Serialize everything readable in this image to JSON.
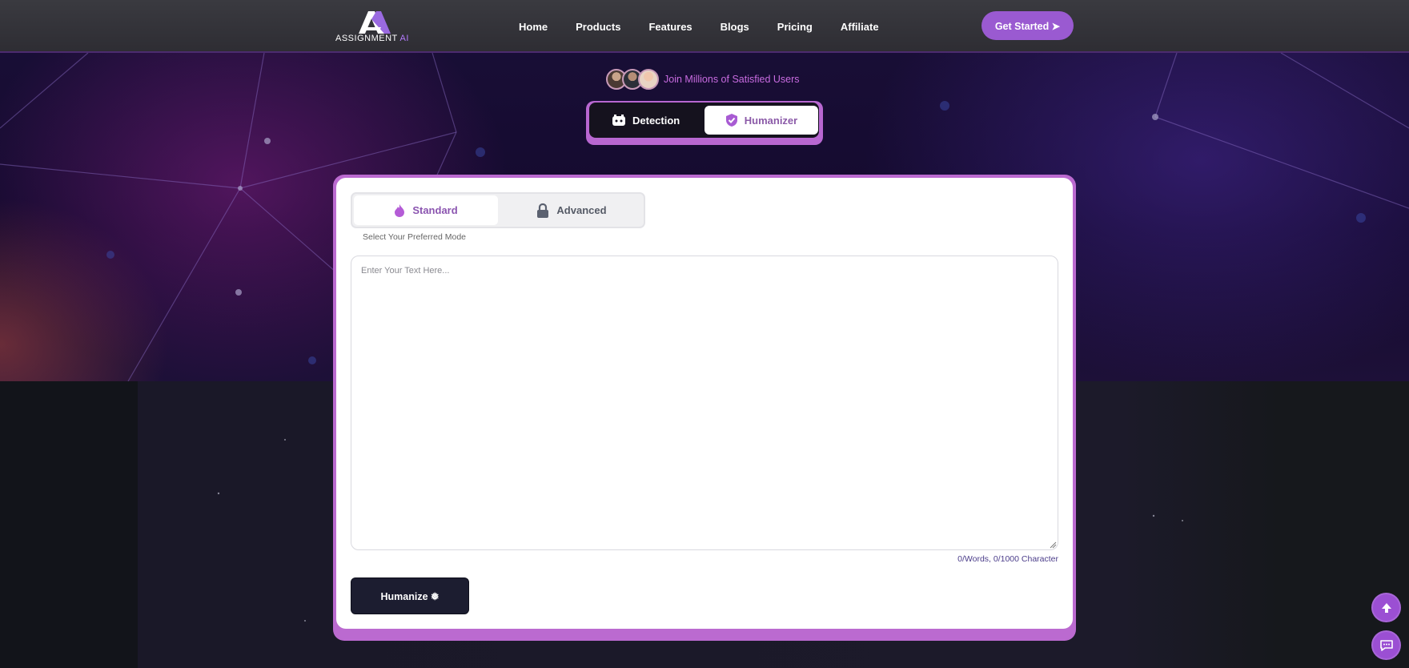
{
  "brand": {
    "logo_text_main": "ASSIGNMENT",
    "logo_text_accent": "AI",
    "accent_color": "#9a5ad1"
  },
  "nav": {
    "items": [
      {
        "label": "Home"
      },
      {
        "label": "Products"
      },
      {
        "label": "Features"
      },
      {
        "label": "Blogs"
      },
      {
        "label": "Pricing"
      },
      {
        "label": "Affiliate"
      }
    ],
    "cta_label": "Get Started ➤"
  },
  "social_proof": {
    "text": "Join Millions of Satisfied Users"
  },
  "tool_tabs": {
    "detection": "Detection",
    "humanizer": "Humanizer",
    "active": "humanizer"
  },
  "modes": {
    "standard": "Standard",
    "advanced": "Advanced",
    "active": "standard",
    "hint": "Select Your Preferred Mode"
  },
  "editor": {
    "placeholder": "Enter Your Text Here...",
    "value": "",
    "counter": "0/Words, 0/1000 Character"
  },
  "action": {
    "humanize_label": "Humanize ❅"
  },
  "icons": {
    "detection": "robot-icon",
    "humanizer": "shield-check-icon",
    "standard": "flame-icon",
    "advanced": "lock-icon",
    "scroll_top": "arrow-up-icon",
    "chat": "chat-icon"
  }
}
